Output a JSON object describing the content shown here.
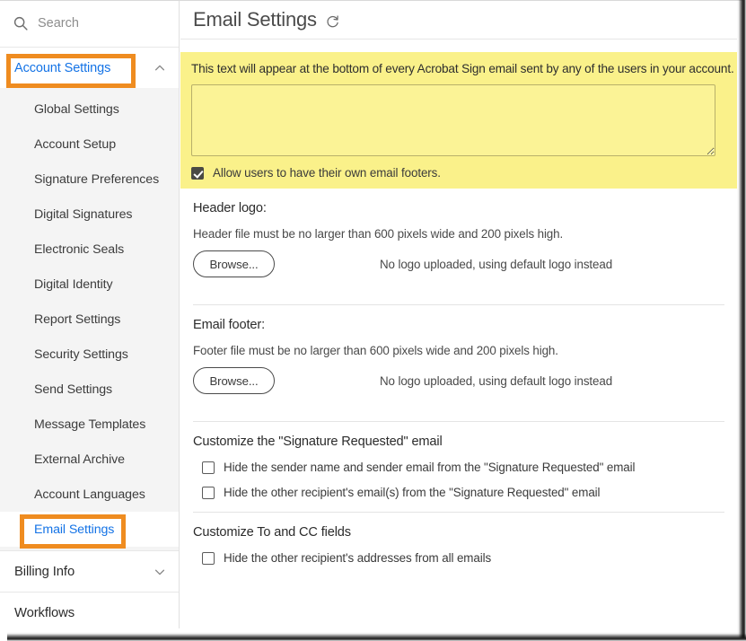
{
  "sidebar": {
    "search": {
      "placeholder": "Search",
      "value": "",
      "icon": "search-icon"
    },
    "account_settings": {
      "label": "Account Settings",
      "icon": "chevron-up-icon",
      "expanded": true
    },
    "submenu": [
      {
        "label": "Global Settings",
        "active": false
      },
      {
        "label": "Account Setup",
        "active": false
      },
      {
        "label": "Signature Preferences",
        "active": false
      },
      {
        "label": "Digital Signatures",
        "active": false
      },
      {
        "label": "Electronic Seals",
        "active": false
      },
      {
        "label": "Digital Identity",
        "active": false
      },
      {
        "label": "Report Settings",
        "active": false
      },
      {
        "label": "Security Settings",
        "active": false
      },
      {
        "label": "Send Settings",
        "active": false
      },
      {
        "label": "Message Templates",
        "active": false
      },
      {
        "label": "External Archive",
        "active": false
      },
      {
        "label": "Account Languages",
        "active": false
      },
      {
        "label": "Email Settings",
        "active": true
      }
    ],
    "billing_info": {
      "label": "Billing Info",
      "icon": "chevron-down-icon"
    },
    "workflows": {
      "label": "Workflows"
    }
  },
  "highlights": {
    "color": "#ef8c20",
    "account_settings_label": "Account Settings",
    "email_settings_label": "Email Settings"
  },
  "main": {
    "title": "Email Settings",
    "refresh_icon": "refresh-icon",
    "email_footer_panel": {
      "background": "#faf18a",
      "description": "This text will appear at the bottom of every Acrobat Sign email sent by any of the users in your account.",
      "textarea_value": "",
      "textarea_placeholder": "",
      "allow_own_footers": {
        "label": "Allow users to have their own email footers.",
        "checked": true
      }
    },
    "header_logo": {
      "title": "Header logo:",
      "note": "Header file must be no larger than 600 pixels wide and 200 pixels high.",
      "browse_label": "Browse...",
      "status": "No logo uploaded, using default logo instead"
    },
    "email_footer_logo": {
      "title": "Email footer:",
      "note": "Footer file must be no larger than 600 pixels wide and 200 pixels high.",
      "browse_label": "Browse...",
      "status": "No logo uploaded, using default logo instead"
    },
    "signature_requested": {
      "title": "Customize the \"Signature Requested\" email",
      "options": [
        {
          "label": "Hide the sender name and sender email from the \"Signature Requested\" email",
          "checked": false
        },
        {
          "label": "Hide the other recipient's email(s) from the \"Signature Requested\" email",
          "checked": false
        }
      ]
    },
    "to_cc_fields": {
      "title": "Customize To and CC fields",
      "options": [
        {
          "label": "Hide the other recipient's addresses from all emails",
          "checked": false
        }
      ]
    }
  }
}
